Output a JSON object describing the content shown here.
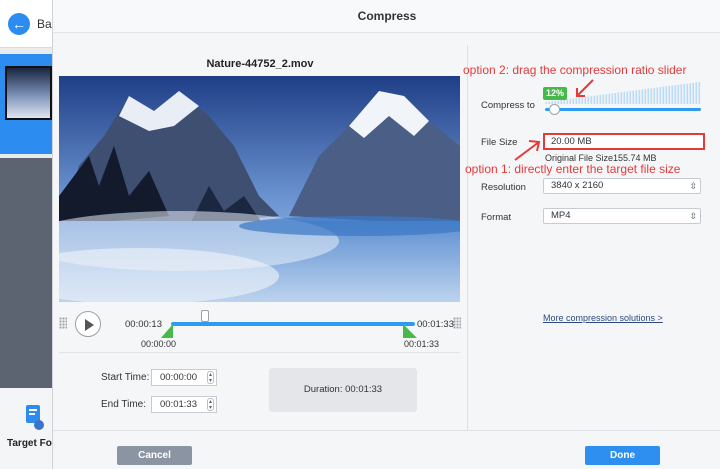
{
  "background_app": {
    "back_label": "Ba",
    "target_format_label": "Target For"
  },
  "dialog": {
    "title": "Compress",
    "file_name": "Nature-44752_2.mov"
  },
  "player": {
    "current_time": "00:00:13",
    "end_time": "00:01:33",
    "clip_start": "00:00:00",
    "clip_end": "00:01:33",
    "start_time_label": "Start Time:",
    "start_time_value": "00:00:00",
    "end_time_label": "End Time:",
    "end_time_value": "00:01:33",
    "duration_label": "Duration:",
    "duration_value": "00:01:33"
  },
  "settings": {
    "compress_to_label": "Compress to",
    "compress_percent": "12%",
    "compress_ratio": 0.12,
    "file_size_label": "File Size",
    "file_size_value": "20.00  MB",
    "original_file_size": "Original File Size155.74 MB",
    "resolution_label": "Resolution",
    "resolution_value": "3840 x 2160",
    "format_label": "Format",
    "format_value": "MP4",
    "more_solutions": "More compression solutions >"
  },
  "annotations": {
    "option2": "option 2: drag the compression ratio slider",
    "option1": "option 1: directly enter the target file size"
  },
  "buttons": {
    "cancel": "Cancel",
    "done": "Done"
  },
  "colors": {
    "accent_blue": "#2d9cf0",
    "annotation_red": "#e53a3a",
    "marker_green": "#47b94a",
    "cancel_gray": "#8b94a2",
    "done_blue": "#2f8ff0"
  }
}
